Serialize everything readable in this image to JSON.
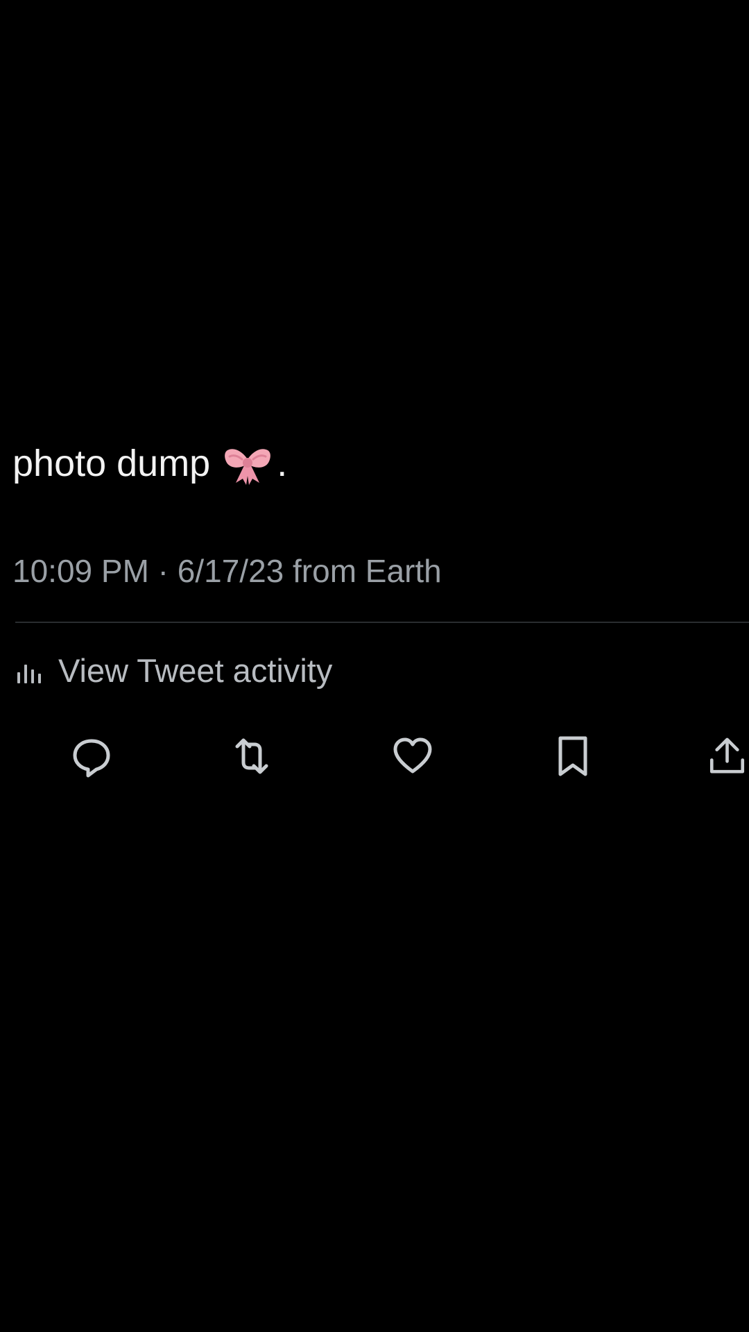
{
  "tweet": {
    "text": "photo dump",
    "emoji_name": "ribbon-bow-icon",
    "trailing_punctuation": ".",
    "timestamp": "10:09 PM · 6/17/23 from Earth"
  },
  "activity": {
    "label": "View Tweet activity"
  },
  "actions": {
    "reply": "reply-icon",
    "retweet": "retweet-icon",
    "like": "heart-icon",
    "bookmark": "bookmark-icon",
    "share": "share-icon"
  },
  "colors": {
    "background": "#000000",
    "primary_text": "#f3f3f3",
    "secondary_text": "#9aa0a6",
    "icon": "#c9cdd1",
    "bow_pink": "#f4a7b6"
  }
}
